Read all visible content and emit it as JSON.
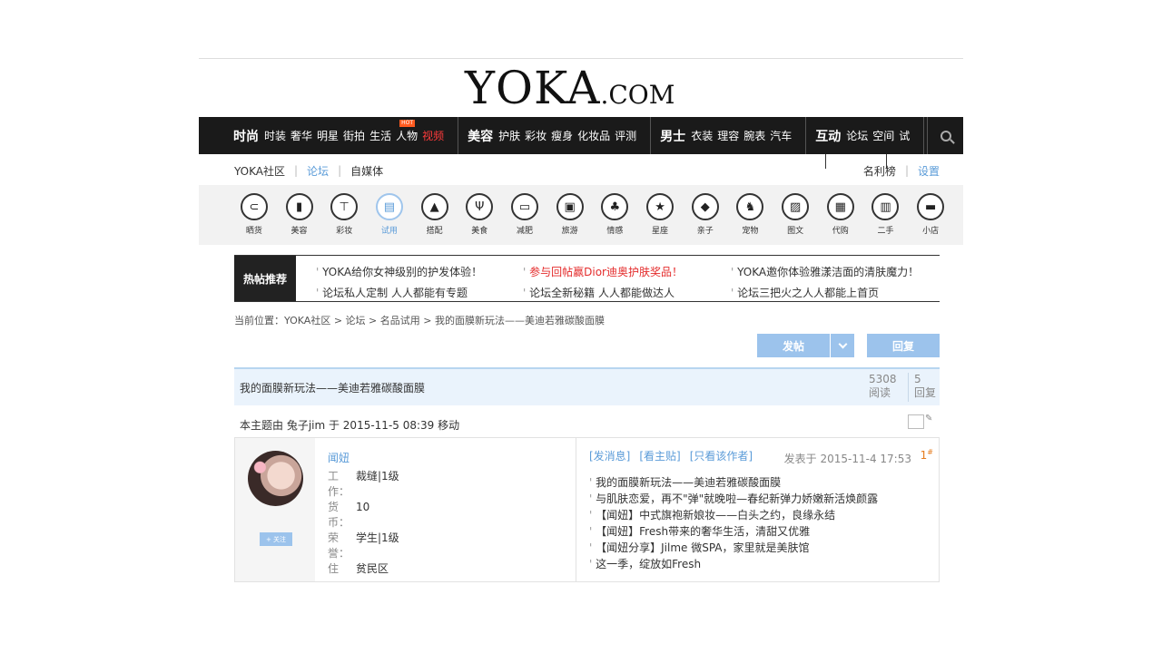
{
  "logo": {
    "main": "YOKA",
    "suffix": ".COM"
  },
  "nav": {
    "groups": [
      {
        "main": "时尚",
        "items": [
          "时装",
          "奢华",
          "明星",
          "街拍",
          "生活",
          "人物",
          "视频"
        ],
        "hot_badge": "HOT"
      },
      {
        "main": "美容",
        "items": [
          "护肤",
          "彩妆",
          "瘦身",
          "化妆品",
          "评测"
        ]
      },
      {
        "main": "男士",
        "items": [
          "衣装",
          "理容",
          "腕表",
          "汽车"
        ]
      },
      {
        "main": "互动",
        "items": [
          "论坛",
          "空间",
          "试"
        ]
      }
    ],
    "accent_red": "#ff3b3b",
    "search_icon": "search-icon"
  },
  "subnav": {
    "left": [
      "YOKA社区",
      "论坛",
      "自媒体"
    ],
    "active": "论坛",
    "right": [
      "名利榜",
      "设置"
    ]
  },
  "categories": [
    {
      "label": "晒货",
      "icon": "bag-icon",
      "glyph": "⊂"
    },
    {
      "label": "美容",
      "icon": "cosmetic-icon",
      "glyph": "▮"
    },
    {
      "label": "彩妆",
      "icon": "makeup-icon",
      "glyph": "⊤"
    },
    {
      "label": "试用",
      "icon": "trial-icon",
      "glyph": "▤"
    },
    {
      "label": "搭配",
      "icon": "dress-icon",
      "glyph": "▲"
    },
    {
      "label": "美食",
      "icon": "food-icon",
      "glyph": "Ψ"
    },
    {
      "label": "减肥",
      "icon": "scale-icon",
      "glyph": "▭"
    },
    {
      "label": "旅游",
      "icon": "luggage-icon",
      "glyph": "▣"
    },
    {
      "label": "情感",
      "icon": "cherry-icon",
      "glyph": "♣"
    },
    {
      "label": "星座",
      "icon": "star-icon",
      "glyph": "★"
    },
    {
      "label": "亲子",
      "icon": "bottle-icon",
      "glyph": "◆"
    },
    {
      "label": "宠物",
      "icon": "pet-icon",
      "glyph": "♞"
    },
    {
      "label": "图文",
      "icon": "picture-icon",
      "glyph": "▨"
    },
    {
      "label": "代购",
      "icon": "gift-icon",
      "glyph": "▦"
    },
    {
      "label": "二手",
      "icon": "secondhand-icon",
      "glyph": "▥"
    },
    {
      "label": "小店",
      "icon": "shop-icon",
      "glyph": "▬"
    }
  ],
  "active_category": "试用",
  "hot": {
    "title": "热帖推荐",
    "links": [
      "YOKA给你女神级别的护发体验！",
      "参与回帖赢Dior迪奥护肤奖品！",
      "YOKA邀你体验雅漾洁面的清肤魔力！",
      "论坛私人定制 人人都能有专题",
      "论坛全新秘籍 人人都能做达人",
      "论坛三把火之人人都能上首页"
    ]
  },
  "breadcrumb": "当前位置：YOKA社区 > 论坛 > 名品试用 > 我的面膜新玩法——美迪若雅碳酸面膜",
  "buttons": {
    "post": "发帖",
    "reply": "回复"
  },
  "thread": {
    "title": "我的面膜新玩法——美迪若雅碳酸面膜",
    "views": "5308",
    "views_label": "阅读",
    "replies": "5",
    "replies_label": "回复",
    "moved_note": "本主题由 兔子jim 于 2015-11-5 08:39 移动"
  },
  "post": {
    "author": "闻妞",
    "follow_label": "+ 关注",
    "info": [
      {
        "key": "工作：",
        "value": "裁缝|1级"
      },
      {
        "key": "货币：",
        "value": "10"
      },
      {
        "key": "荣誉：",
        "value": "学生|1级"
      },
      {
        "key": "住",
        "value": "贫民区"
      }
    ],
    "tools": [
      "[发消息]",
      "[看主贴]",
      "[只看该作者]"
    ],
    "date": "发表于 2015-11-4 17:53",
    "floor": "1",
    "floor_mark": "#",
    "links": [
      "我的面膜新玩法——美迪若雅碳酸面膜",
      "与肌肤恋爱，再不\"弹\"就晚啦—春纪新弹力娇嫩新活焕颜露",
      "【闻妞】中式旗袍新娘妆——白头之约，良缘永结",
      "【闻妞】Fresh带来的奢华生活，清甜又优雅",
      "【闻妞分享】Jilme 微SPA，家里就是美肤馆",
      "这一季，绽放如Fresh"
    ]
  },
  "colors": {
    "accent_blue": "#5a9bd8",
    "button_blue": "#9cc3ec",
    "nav_bg": "#1a1a1a"
  }
}
